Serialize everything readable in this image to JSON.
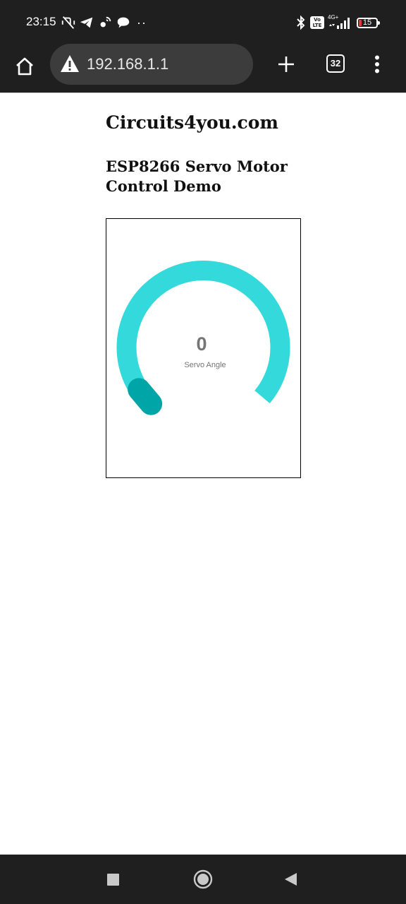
{
  "status_bar": {
    "time": "23:15",
    "more_indicator": "··",
    "volte_label": "Vo\nLTE",
    "network_type": "4G+",
    "battery_level": "15",
    "battery_fraction": 0.15,
    "icons": [
      "vibrate-off-icon",
      "telegram-icon",
      "satellite-icon",
      "chat-icon",
      "bluetooth-icon",
      "volte-icon",
      "signal-icon",
      "battery-icon"
    ]
  },
  "browser": {
    "url": "192.168.1.1",
    "tab_count": "32",
    "icons": [
      "home-icon",
      "warning-icon",
      "plus-icon",
      "tab-switcher-icon",
      "menu-dots-icon"
    ]
  },
  "page": {
    "title": "Circuits4you.com",
    "heading": "ESP8266 Servo Motor Control Demo",
    "gauge": {
      "value": "0",
      "label": "Servo Angle",
      "min": 0,
      "max": 180,
      "current": 0,
      "track_color": "#33d9db",
      "knob_color": "#00a5a8"
    }
  },
  "nav_bar": {
    "icons": [
      "recents-icon",
      "home-circle-icon",
      "back-icon"
    ]
  }
}
